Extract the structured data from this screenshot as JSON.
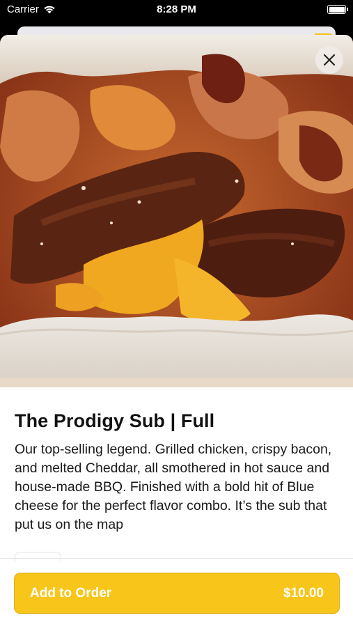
{
  "status_bar": {
    "carrier": "Carrier",
    "time": "8:28 PM"
  },
  "product": {
    "image_alt": "BBQ chicken, bacon and cheddar sub sandwich",
    "title": "The Prodigy Sub | Full",
    "description": "Our top-selling legend. Grilled chicken, crispy bacon, and melted Cheddar, all smothered in hot sauce and house-made BBQ. Finished with a bold hit of Blue cheese for the perfect flavor combo. It’s the sub that put us on the map"
  },
  "actions": {
    "add_label": "Add to Order",
    "price": "$10.00"
  },
  "colors": {
    "accent": "#f8c51b",
    "background": "#ffffff",
    "text": "#111111"
  },
  "icons": {
    "close": "close-icon",
    "wifi": "wifi-icon",
    "battery": "battery-icon"
  }
}
